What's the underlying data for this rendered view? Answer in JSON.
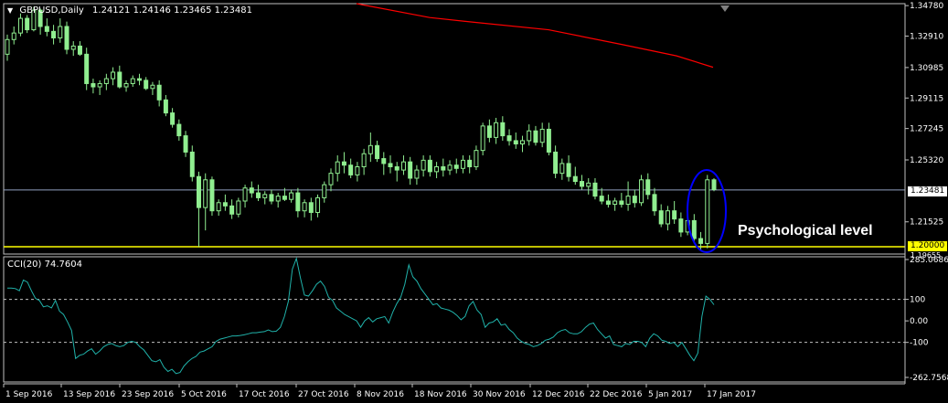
{
  "header": {
    "symbol": "GBPUSD,Daily",
    "ohlc": "1.24121 1.24146 1.23465 1.23481"
  },
  "indicator": {
    "label": "CCI(20) 74.7604"
  },
  "annotation": "Psychological level",
  "price_tags": {
    "current": "1.23481",
    "level": "1.20000",
    "low_overlap": "1.19655"
  },
  "colors": {
    "background": "#000000",
    "bull": "#90EE90",
    "ma": "#ff0000",
    "cci": "#20B2AA",
    "level": "#ffff00",
    "circle": "#0000ff",
    "grid": "#808080"
  },
  "chart_data": [
    {
      "type": "candlestick",
      "title": "GBPUSD,Daily",
      "y_ticks": [
        "1.34780",
        "1.32910",
        "1.30985",
        "1.29115",
        "1.27245",
        "1.25320",
        "1.23481",
        "1.21525",
        "1.20000"
      ],
      "ylim": [
        1.1955,
        1.349
      ],
      "x_ticks": [
        "1 Sep 2016",
        "13 Sep 2016",
        "23 Sep 2016",
        "5 Oct 2016",
        "17 Oct 2016",
        "27 Oct 2016",
        "8 Nov 2016",
        "18 Nov 2016",
        "30 Nov 2016",
        "12 Dec 2016",
        "22 Dec 2016",
        "5 Jan 2017",
        "17 Jan 2017"
      ],
      "horizontal_lines": [
        {
          "name": "current price",
          "value": 1.23481,
          "color": "#90a0c0"
        },
        {
          "name": "Psychological level",
          "value": 1.2,
          "color": "#ffff00"
        }
      ],
      "candles": [
        [
          1.318,
          1.33,
          1.314,
          1.327
        ],
        [
          1.327,
          1.335,
          1.324,
          1.331
        ],
        [
          1.331,
          1.343,
          1.329,
          1.34
        ],
        [
          1.34,
          1.342,
          1.331,
          1.333
        ],
        [
          1.333,
          1.347,
          1.332,
          1.345
        ],
        [
          1.345,
          1.346,
          1.33,
          1.335
        ],
        [
          1.335,
          1.34,
          1.329,
          1.332
        ],
        [
          1.332,
          1.336,
          1.324,
          1.328
        ],
        [
          1.328,
          1.34,
          1.325,
          1.335
        ],
        [
          1.335,
          1.338,
          1.318,
          1.321
        ],
        [
          1.321,
          1.326,
          1.317,
          1.323
        ],
        [
          1.323,
          1.326,
          1.317,
          1.318
        ],
        [
          1.318,
          1.322,
          1.296,
          1.3
        ],
        [
          1.3,
          1.303,
          1.294,
          1.298
        ],
        [
          1.298,
          1.302,
          1.293,
          1.3
        ],
        [
          1.3,
          1.306,
          1.296,
          1.303
        ],
        [
          1.303,
          1.31,
          1.299,
          1.307
        ],
        [
          1.307,
          1.311,
          1.297,
          1.298
        ],
        [
          1.298,
          1.302,
          1.295,
          1.3
        ],
        [
          1.3,
          1.305,
          1.298,
          1.303
        ],
        [
          1.303,
          1.306,
          1.299,
          1.302
        ],
        [
          1.302,
          1.304,
          1.296,
          1.297
        ],
        [
          1.297,
          1.301,
          1.293,
          1.299
        ],
        [
          1.299,
          1.302,
          1.286,
          1.29
        ],
        [
          1.29,
          1.293,
          1.28,
          1.282
        ],
        [
          1.282,
          1.285,
          1.273,
          1.275
        ],
        [
          1.275,
          1.278,
          1.265,
          1.268
        ],
        [
          1.268,
          1.271,
          1.255,
          1.258
        ],
        [
          1.258,
          1.262,
          1.24,
          1.243
        ],
        [
          1.243,
          1.246,
          1.2,
          1.224
        ],
        [
          1.224,
          1.245,
          1.21,
          1.241
        ],
        [
          1.241,
          1.243,
          1.219,
          1.222
        ],
        [
          1.222,
          1.229,
          1.219,
          1.227
        ],
        [
          1.227,
          1.232,
          1.222,
          1.225
        ],
        [
          1.225,
          1.229,
          1.217,
          1.22
        ],
        [
          1.22,
          1.23,
          1.218,
          1.228
        ],
        [
          1.228,
          1.238,
          1.224,
          1.236
        ],
        [
          1.236,
          1.24,
          1.23,
          1.233
        ],
        [
          1.233,
          1.238,
          1.228,
          1.23
        ],
        [
          1.23,
          1.234,
          1.226,
          1.232
        ],
        [
          1.232,
          1.235,
          1.226,
          1.228
        ],
        [
          1.228,
          1.233,
          1.224,
          1.231
        ],
        [
          1.231,
          1.236,
          1.228,
          1.229
        ],
        [
          1.229,
          1.235,
          1.227,
          1.233
        ],
        [
          1.233,
          1.236,
          1.218,
          1.222
        ],
        [
          1.222,
          1.229,
          1.218,
          1.227
        ],
        [
          1.227,
          1.23,
          1.216,
          1.221
        ],
        [
          1.221,
          1.232,
          1.218,
          1.23
        ],
        [
          1.23,
          1.24,
          1.227,
          1.238
        ],
        [
          1.238,
          1.248,
          1.234,
          1.245
        ],
        [
          1.245,
          1.256,
          1.24,
          1.252
        ],
        [
          1.252,
          1.258,
          1.245,
          1.25
        ],
        [
          1.25,
          1.254,
          1.242,
          1.244
        ],
        [
          1.244,
          1.252,
          1.24,
          1.249
        ],
        [
          1.249,
          1.26,
          1.244,
          1.257
        ],
        [
          1.257,
          1.27,
          1.252,
          1.262
        ],
        [
          1.262,
          1.265,
          1.252,
          1.254
        ],
        [
          1.254,
          1.258,
          1.244,
          1.251
        ],
        [
          1.251,
          1.256,
          1.245,
          1.249
        ],
        [
          1.249,
          1.252,
          1.24,
          1.247
        ],
        [
          1.247,
          1.256,
          1.244,
          1.252
        ],
        [
          1.252,
          1.255,
          1.238,
          1.242
        ],
        [
          1.242,
          1.25,
          1.238,
          1.247
        ],
        [
          1.247,
          1.256,
          1.243,
          1.253
        ],
        [
          1.253,
          1.256,
          1.243,
          1.246
        ],
        [
          1.246,
          1.252,
          1.242,
          1.249
        ],
        [
          1.249,
          1.254,
          1.243,
          1.247
        ],
        [
          1.247,
          1.253,
          1.244,
          1.25
        ],
        [
          1.25,
          1.254,
          1.245,
          1.248
        ],
        [
          1.248,
          1.256,
          1.245,
          1.253
        ],
        [
          1.253,
          1.256,
          1.245,
          1.249
        ],
        [
          1.249,
          1.262,
          1.247,
          1.259
        ],
        [
          1.259,
          1.276,
          1.256,
          1.274
        ],
        [
          1.274,
          1.278,
          1.264,
          1.267
        ],
        [
          1.267,
          1.279,
          1.263,
          1.276
        ],
        [
          1.276,
          1.28,
          1.265,
          1.268
        ],
        [
          1.268,
          1.272,
          1.262,
          1.265
        ],
        [
          1.265,
          1.27,
          1.26,
          1.263
        ],
        [
          1.263,
          1.268,
          1.258,
          1.265
        ],
        [
          1.265,
          1.275,
          1.262,
          1.271
        ],
        [
          1.271,
          1.274,
          1.262,
          1.264
        ],
        [
          1.264,
          1.276,
          1.261,
          1.272
        ],
        [
          1.272,
          1.276,
          1.256,
          1.258
        ],
        [
          1.258,
          1.262,
          1.242,
          1.245
        ],
        [
          1.245,
          1.254,
          1.241,
          1.251
        ],
        [
          1.251,
          1.256,
          1.24,
          1.243
        ],
        [
          1.243,
          1.249,
          1.238,
          1.24
        ],
        [
          1.24,
          1.244,
          1.235,
          1.237
        ],
        [
          1.237,
          1.242,
          1.232,
          1.239
        ],
        [
          1.239,
          1.242,
          1.229,
          1.231
        ],
        [
          1.231,
          1.236,
          1.226,
          1.228
        ],
        [
          1.228,
          1.232,
          1.224,
          1.226
        ],
        [
          1.226,
          1.23,
          1.222,
          1.228
        ],
        [
          1.228,
          1.233,
          1.224,
          1.226
        ],
        [
          1.226,
          1.24,
          1.222,
          1.231
        ],
        [
          1.231,
          1.235,
          1.224,
          1.227
        ],
        [
          1.227,
          1.244,
          1.225,
          1.241
        ],
        [
          1.241,
          1.245,
          1.229,
          1.232
        ],
        [
          1.232,
          1.236,
          1.219,
          1.222
        ],
        [
          1.222,
          1.226,
          1.212,
          1.214
        ],
        [
          1.214,
          1.225,
          1.21,
          1.222
        ],
        [
          1.222,
          1.228,
          1.214,
          1.217
        ],
        [
          1.217,
          1.221,
          1.206,
          1.209
        ],
        [
          1.209,
          1.219,
          1.207,
          1.216
        ],
        [
          1.216,
          1.22,
          1.202,
          1.205
        ],
        [
          1.205,
          1.209,
          1.198,
          1.202
        ],
        [
          1.202,
          1.244,
          1.199,
          1.241
        ],
        [
          1.241,
          1.242,
          1.234,
          1.235
        ]
      ]
    },
    {
      "type": "line",
      "title": "CCI(20) 74.7604",
      "y_ticks": [
        "285.0686",
        "100",
        "0.00",
        "-100",
        "-262.7568"
      ],
      "ylim": [
        -262.7568,
        285.0686
      ],
      "reference_lines": [
        100,
        -100
      ],
      "values": [
        152,
        152,
        150,
        140,
        190,
        180,
        140,
        105,
        95,
        65,
        70,
        60,
        95,
        45,
        30,
        -5,
        -45,
        -175,
        -160,
        -155,
        -140,
        -130,
        -155,
        -140,
        -120,
        -110,
        -105,
        -115,
        -120,
        -115,
        -100,
        -95,
        -100,
        -120,
        -135,
        -160,
        -185,
        -190,
        -180,
        -215,
        -235,
        -225,
        -245,
        -240,
        -210,
        -190,
        -175,
        -165,
        -145,
        -140,
        -130,
        -120,
        -95,
        -85,
        -80,
        -75,
        -70,
        -70,
        -68,
        -65,
        -60,
        -55,
        -55,
        -52,
        -50,
        -42,
        -50,
        -48,
        -30,
        20,
        90,
        240,
        290,
        200,
        120,
        115,
        140,
        170,
        185,
        160,
        110,
        95,
        60,
        45,
        30,
        20,
        10,
        0,
        -30,
        0,
        15,
        -5,
        10,
        15,
        20,
        -10,
        40,
        80,
        110,
        170,
        260,
        205,
        185,
        150,
        125,
        100,
        75,
        80,
        60,
        55,
        50,
        40,
        25,
        5,
        20,
        70,
        90,
        50,
        30,
        -30,
        -10,
        -5,
        10,
        -20,
        -15,
        -40,
        -55,
        -80,
        -95,
        -105,
        -110,
        -120,
        -115,
        -105,
        -90,
        -85,
        -75,
        -55,
        -45,
        -40,
        -55,
        -60,
        -60,
        -50,
        -30,
        -15,
        -10,
        -40,
        -60,
        -80,
        -70,
        -110,
        -115,
        -120,
        -105,
        -110,
        -95,
        -95,
        -100,
        -120,
        -80,
        -60,
        -70,
        -90,
        -95,
        -105,
        -100,
        -120,
        -100,
        -130,
        -160,
        -185,
        -150,
        20,
        115,
        100,
        75
      ]
    }
  ]
}
